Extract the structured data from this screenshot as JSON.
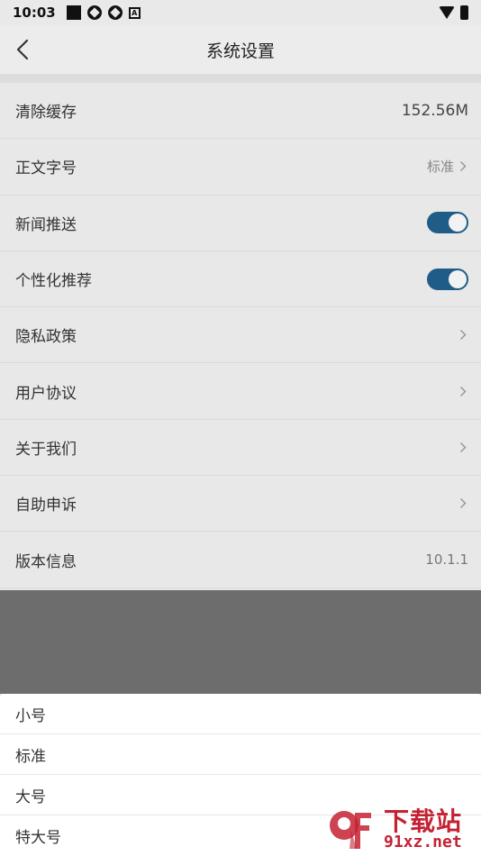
{
  "statusbar": {
    "time": "10:03",
    "a_icon": "A"
  },
  "header": {
    "title": "系统设置"
  },
  "settings": {
    "clear_cache": {
      "label": "清除缓存",
      "value": "152.56M"
    },
    "font_size": {
      "label": "正文字号",
      "value": "标准"
    },
    "news_push": {
      "label": "新闻推送",
      "on": true
    },
    "personalized": {
      "label": "个性化推荐",
      "on": true
    },
    "privacy": {
      "label": "隐私政策"
    },
    "agreement": {
      "label": "用户协议"
    },
    "about": {
      "label": "关于我们"
    },
    "appeal": {
      "label": "自助申诉"
    },
    "version": {
      "label": "版本信息",
      "value": "10.1.1"
    }
  },
  "sheet": {
    "options": [
      "小号",
      "标准",
      "大号",
      "特大号"
    ]
  },
  "watermark": {
    "title": "下载站",
    "domain": "91xz.net",
    "logo": "9f"
  },
  "colors": {
    "toggle_on": "#1f5d88",
    "overlay": "#6d6d6d",
    "watermark": "#c42233"
  }
}
